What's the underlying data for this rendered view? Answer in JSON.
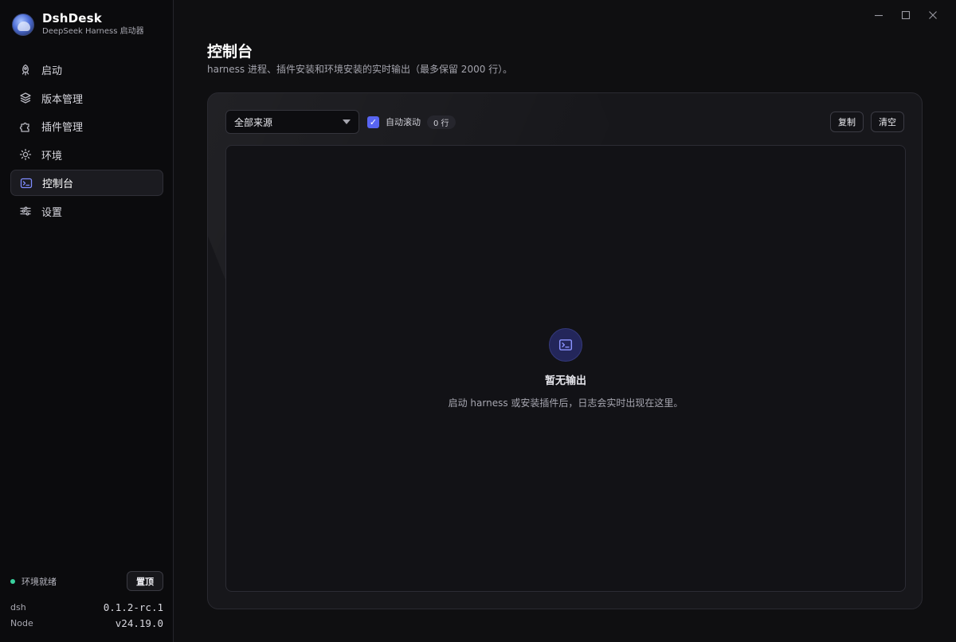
{
  "brand": {
    "title": "DshDesk",
    "subtitle": "DeepSeek Harness 启动器"
  },
  "window": {
    "minimize_icon": "minimize-icon",
    "maximize_icon": "maximize-icon",
    "close_icon": "close-icon"
  },
  "nav": {
    "items": [
      {
        "label": "启动",
        "icon": "rocket-icon",
        "active": false
      },
      {
        "label": "版本管理",
        "icon": "layers-icon",
        "active": false
      },
      {
        "label": "插件管理",
        "icon": "puzzle-icon",
        "active": false
      },
      {
        "label": "环境",
        "icon": "sun-icon",
        "active": false
      },
      {
        "label": "控制台",
        "icon": "terminal-icon",
        "active": true
      },
      {
        "label": "设置",
        "icon": "sliders-icon",
        "active": false
      }
    ]
  },
  "footer": {
    "status": "环境就绪",
    "status_color": "#3ad29f",
    "pin_label": "置顶",
    "versions": [
      {
        "label": "dsh",
        "value": "0.1.2-rc.1"
      },
      {
        "label": "Node",
        "value": "v24.19.0"
      }
    ]
  },
  "page": {
    "title": "控制台",
    "subtitle": "harness 进程、插件安装和环境安装的实时输出（最多保留 2000 行）。"
  },
  "toolbar": {
    "source_select": "全部来源",
    "autoscroll_label": "自动滚动",
    "autoscroll_checked": true,
    "line_count": "0 行",
    "copy_label": "复制",
    "clear_label": "清空"
  },
  "empty_state": {
    "icon": "terminal-icon",
    "title": "暂无输出",
    "description": "启动 harness 或安装插件后，日志会实时出现在这里。"
  },
  "colors": {
    "accent": "#5865f2",
    "background": "#0f0f11"
  }
}
